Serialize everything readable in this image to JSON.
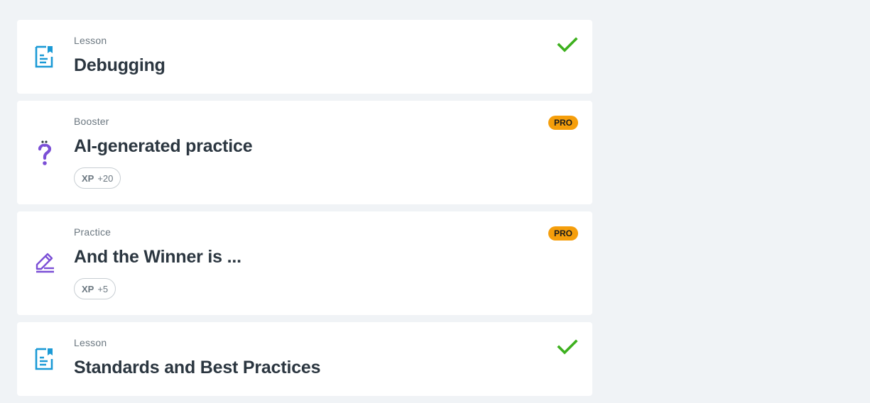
{
  "items": [
    {
      "type": "Lesson",
      "title": "Debugging",
      "icon": "lesson-document-icon",
      "completed": true
    },
    {
      "type": "Booster",
      "title": "AI-generated practice",
      "icon": "question-mark-icon",
      "badge": "PRO",
      "xp_label": "XP",
      "xp_value": "+20"
    },
    {
      "type": "Practice",
      "title": "And the Winner is ...",
      "icon": "pencil-edit-icon",
      "badge": "PRO",
      "xp_label": "XP",
      "xp_value": "+5"
    },
    {
      "type": "Lesson",
      "title": "Standards and Best Practices",
      "icon": "lesson-document-icon",
      "completed": true
    }
  ],
  "colors": {
    "background": "#f0f3f6",
    "lesson_icon": "#1b9ad6",
    "booster_icon": "#7b4fd6",
    "practice_icon": "#7b4fd6",
    "check": "#3db01e",
    "pro_badge": "#f59e0b"
  }
}
